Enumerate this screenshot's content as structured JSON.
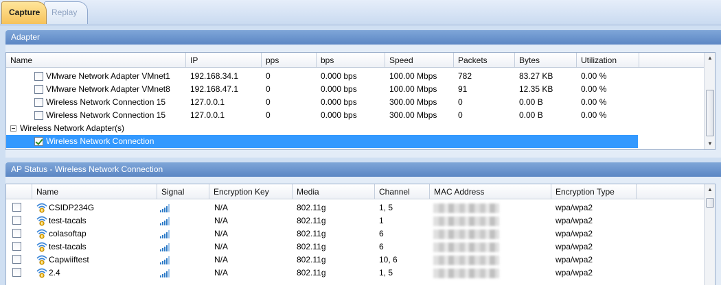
{
  "tabs": [
    {
      "label": "Capture",
      "active": true
    },
    {
      "label": "Replay",
      "active": false
    }
  ],
  "adapter_panel": {
    "title": "Adapter",
    "columns": [
      "Name",
      "IP",
      "pps",
      "bps",
      "Speed",
      "Packets",
      "Bytes",
      "Utilization"
    ],
    "rows": [
      {
        "name": "VMware Network Adapter VMnet1",
        "ip": "192.168.34.1",
        "pps": "0",
        "bps": "0.000 bps",
        "speed": "100.00 Mbps",
        "packets": "782",
        "bytes": "83.27 KB",
        "utilization": "0.00 %",
        "checked": false
      },
      {
        "name": "VMware Network Adapter VMnet8",
        "ip": "192.168.47.1",
        "pps": "0",
        "bps": "0.000 bps",
        "speed": "100.00 Mbps",
        "packets": "91",
        "bytes": "12.35 KB",
        "utilization": "0.00 %",
        "checked": false
      },
      {
        "name": "Wireless Network Connection 15",
        "ip": "127.0.0.1",
        "pps": "0",
        "bps": "0.000 bps",
        "speed": "300.00 Mbps",
        "packets": "0",
        "bytes": "0.00 B",
        "utilization": "0.00 %",
        "checked": false
      },
      {
        "name": "Wireless Network Connection 15",
        "ip": "127.0.0.1",
        "pps": "0",
        "bps": "0.000 bps",
        "speed": "300.00 Mbps",
        "packets": "0",
        "bytes": "0.00 B",
        "utilization": "0.00 %",
        "checked": false
      }
    ],
    "group_label": "Wireless Network Adapter(s)",
    "selected_row": {
      "name": "Wireless Network Connection",
      "checked": true
    }
  },
  "ap_panel": {
    "title": "AP Status - Wireless Network Connection",
    "columns": [
      "Name",
      "Signal",
      "Encryption Key",
      "Media",
      "Channel",
      "MAC Address",
      "Encryption Type"
    ],
    "rows": [
      {
        "name": "CSIDP234G",
        "key": "N/A",
        "media": "802.11g",
        "channel": "1, 5",
        "enc": "wpa/wpa2"
      },
      {
        "name": "test-tacals",
        "key": "N/A",
        "media": "802.11g",
        "channel": "1",
        "enc": "wpa/wpa2"
      },
      {
        "name": "colasoftap",
        "key": "N/A",
        "media": "802.11g",
        "channel": "6",
        "enc": "wpa/wpa2"
      },
      {
        "name": "test-tacals",
        "key": "N/A",
        "media": "802.11g",
        "channel": "6",
        "enc": "wpa/wpa2"
      },
      {
        "name": "Capwiiftest",
        "key": "N/A",
        "media": "802.11g",
        "channel": "10, 6",
        "enc": "wpa/wpa2"
      },
      {
        "name": "2.4",
        "key": "N/A",
        "media": "802.11g",
        "channel": "1, 5",
        "enc": "wpa/wpa2"
      }
    ]
  },
  "icons": {
    "wifi": "wifi-network-icon",
    "signal": "signal-strength-icon"
  },
  "colors": {
    "selection": "#3399ff",
    "active_tab": "#f6c25a",
    "panel_header": "#6a93cd"
  }
}
